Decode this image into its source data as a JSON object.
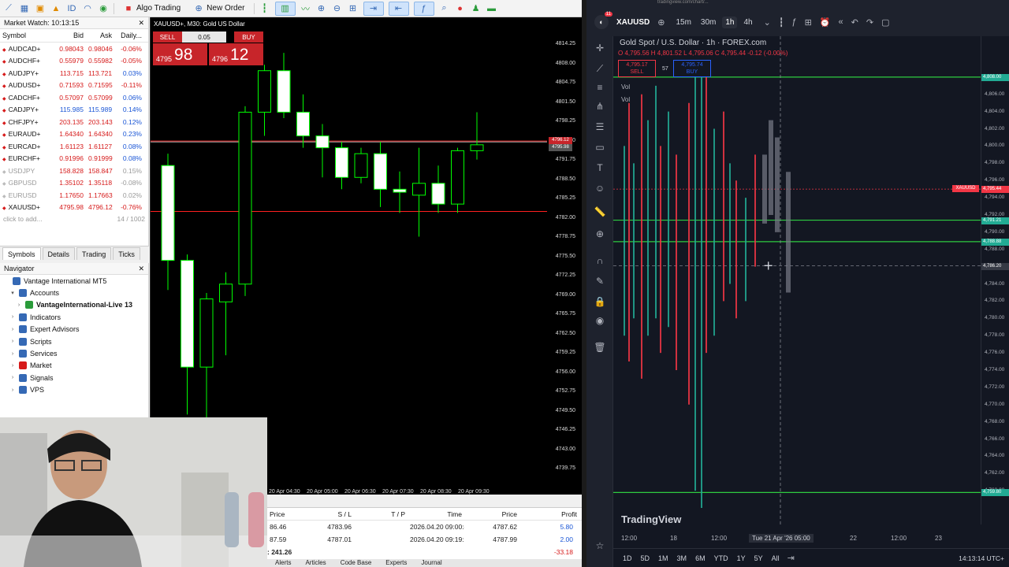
{
  "mt5": {
    "toolbar": {
      "algo_trading": "Algo Trading",
      "new_order": "New Order"
    },
    "market_watch": {
      "title": "Market Watch: 10:13:15",
      "columns": [
        "Symbol",
        "Bid",
        "Ask",
        "Daily..."
      ],
      "rows": [
        {
          "symbol": "AUDCAD+",
          "bid": "0.98043",
          "ask": "0.98046",
          "change": "-0.06%",
          "dir": "down",
          "dim": false
        },
        {
          "symbol": "AUDCHF+",
          "bid": "0.55979",
          "ask": "0.55982",
          "change": "-0.05%",
          "dir": "down",
          "dim": false
        },
        {
          "symbol": "AUDJPY+",
          "bid": "113.715",
          "ask": "113.721",
          "change": "0.03%",
          "dir": "down",
          "dim": false
        },
        {
          "symbol": "AUDUSD+",
          "bid": "0.71593",
          "ask": "0.71595",
          "change": "-0.11%",
          "dir": "down",
          "dim": false
        },
        {
          "symbol": "CADCHF+",
          "bid": "0.57097",
          "ask": "0.57099",
          "change": "0.06%",
          "dir": "down",
          "dim": false
        },
        {
          "symbol": "CADJPY+",
          "bid": "115.985",
          "ask": "115.989",
          "change": "0.14%",
          "dir": "up",
          "dim": false
        },
        {
          "symbol": "CHFJPY+",
          "bid": "203.135",
          "ask": "203.143",
          "change": "0.12%",
          "dir": "down",
          "dim": false
        },
        {
          "symbol": "EURAUD+",
          "bid": "1.64340",
          "ask": "1.64340",
          "change": "0.23%",
          "dir": "down",
          "dim": false
        },
        {
          "symbol": "EURCAD+",
          "bid": "1.61123",
          "ask": "1.61127",
          "change": "0.08%",
          "dir": "down",
          "dim": false
        },
        {
          "symbol": "EURCHF+",
          "bid": "0.91996",
          "ask": "0.91999",
          "change": "0.08%",
          "dir": "down",
          "dim": false
        },
        {
          "symbol": "USDJPY",
          "bid": "158.828",
          "ask": "158.847",
          "change": "0.15%",
          "dir": "down",
          "dim": true
        },
        {
          "symbol": "GBPUSD",
          "bid": "1.35102",
          "ask": "1.35118",
          "change": "-0.08%",
          "dir": "down",
          "dim": true
        },
        {
          "symbol": "EURUSD",
          "bid": "1.17650",
          "ask": "1.17663",
          "change": "0.02%",
          "dir": "down",
          "dim": true
        },
        {
          "symbol": "XAUUSD+",
          "bid": "4795.98",
          "ask": "4796.12",
          "change": "-0.76%",
          "dir": "down",
          "dim": false
        }
      ],
      "add_label": "click to add...",
      "count": "14 / 1002",
      "tabs": [
        "Symbols",
        "Details",
        "Trading",
        "Ticks"
      ]
    },
    "navigator": {
      "title": "Navigator",
      "items": [
        {
          "label": "Vantage International MT5",
          "level": 0,
          "caret": "",
          "color": "#3569b5"
        },
        {
          "label": "Accounts",
          "level": 1,
          "caret": "▾",
          "color": "#3569b5"
        },
        {
          "label": "VantageInternational-Live 13",
          "level": 2,
          "caret": "›",
          "color": "#2a9b3a",
          "bold": true
        },
        {
          "label": "Indicators",
          "level": 1,
          "caret": "›",
          "color": "#3569b5"
        },
        {
          "label": "Expert Advisors",
          "level": 1,
          "caret": "›",
          "color": "#3569b5"
        },
        {
          "label": "Scripts",
          "level": 1,
          "caret": "›",
          "color": "#3569b5"
        },
        {
          "label": "Services",
          "level": 1,
          "caret": "›",
          "color": "#3569b5"
        },
        {
          "label": "Market",
          "level": 1,
          "caret": "›",
          "color": "#d61a1a"
        },
        {
          "label": "Signals",
          "level": 1,
          "caret": "›",
          "color": "#3569b5"
        },
        {
          "label": "VPS",
          "level": 1,
          "caret": "›",
          "color": "#3569b5"
        }
      ]
    },
    "chart": {
      "title": "XAUUSD+, M30: Gold US Dollar",
      "sell_label": "SELL",
      "buy_label": "BUY",
      "lot": "0.05",
      "sell_price_small": "4795",
      "sell_price_big": "98",
      "buy_price_small": "4796",
      "buy_price_big": "12",
      "price_labels": [
        "4814.25",
        "4808.00",
        "4804.75",
        "4801.50",
        "4798.25",
        "4795.00",
        "4791.75",
        "4788.50",
        "4785.25",
        "4782.00",
        "4778.75",
        "4775.50",
        "4772.25",
        "4769.00",
        "4765.75",
        "4762.50",
        "4759.25",
        "4756.00",
        "4752.75",
        "4749.50",
        "4746.25",
        "4743.00",
        "4739.75"
      ],
      "time_labels": [
        "20 Apr 04:30",
        "20 Apr 05:00",
        "20 Apr 06:30",
        "20 Apr 07:30",
        "20 Apr 08:30",
        "20 Apr 09:30"
      ],
      "candles": [
        {
          "o": 4792.0,
          "h": 4794.0,
          "l": 4771.0,
          "c": 4776.0
        },
        {
          "o": 4776.0,
          "h": 4777.0,
          "l": 4750.0,
          "c": 4758.0
        },
        {
          "o": 4758.0,
          "h": 4770.5,
          "l": 4746.0,
          "c": 4769.5
        },
        {
          "o": 4769.0,
          "h": 4774.0,
          "l": 4760.0,
          "c": 4772.0
        },
        {
          "o": 4772.0,
          "h": 4802.0,
          "l": 4770.0,
          "c": 4801.0
        },
        {
          "o": 4801.0,
          "h": 4809.0,
          "l": 4797.0,
          "c": 4808.0
        },
        {
          "o": 4808.0,
          "h": 4811.0,
          "l": 4800.0,
          "c": 4801.0
        },
        {
          "o": 4801.0,
          "h": 4804.0,
          "l": 4795.0,
          "c": 4797.0
        },
        {
          "o": 4797.0,
          "h": 4799.0,
          "l": 4790.0,
          "c": 4795.0
        },
        {
          "o": 4795.0,
          "h": 4796.0,
          "l": 4788.0,
          "c": 4790.0
        },
        {
          "o": 4790.0,
          "h": 4795.0,
          "l": 4789.0,
          "c": 4794.0
        },
        {
          "o": 4794.0,
          "h": 4796.0,
          "l": 4785.0,
          "c": 4788.0
        },
        {
          "o": 4788.0,
          "h": 4791.0,
          "l": 4784.0,
          "c": 4787.5
        },
        {
          "o": 4787.0,
          "h": 4795.0,
          "l": 4780.0,
          "c": 4789.0
        },
        {
          "o": 4789.0,
          "h": 4792.0,
          "l": 4784.0,
          "c": 4785.5
        },
        {
          "o": 4785.5,
          "h": 4795.0,
          "l": 4784.0,
          "c": 4794.5
        },
        {
          "o": 4794.5,
          "h": 4801.0,
          "l": 4793.0,
          "c": 4795.5
        }
      ],
      "ask_line": 4796.12,
      "bid_line": 4795.98,
      "level_line": 4784.25,
      "ask_label": "4796.12",
      "bid_label": "4795.98"
    },
    "toolbox": {
      "columns": [
        "Price",
        "S / L",
        "T / P",
        "Time",
        "Price",
        "Profit"
      ],
      "rows": [
        {
          "open": "86.46",
          "sl": "4783.96",
          "tp": "",
          "time": "2026.04.20 09:00:49",
          "price": "4787.62",
          "profit": "5.80"
        },
        {
          "open": "87.59",
          "sl": "4787.01",
          "tp": "",
          "time": "2026.04.20 09:19:25",
          "price": "4787.99",
          "profit": "2.00"
        }
      ],
      "balance": ": 241.26",
      "total_profit": "-33.18",
      "tabs": [
        "Alerts",
        "Articles",
        "Code Base",
        "Experts",
        "Journal"
      ]
    }
  },
  "tv": {
    "url": "tradingview.com/chart/...",
    "symbol": "XAUUSD",
    "notif_count": "11",
    "intervals": [
      {
        "label": "15m",
        "active": false
      },
      {
        "label": "30m",
        "active": false
      },
      {
        "label": "1h",
        "active": true
      },
      {
        "label": "4h",
        "active": false
      }
    ],
    "legend_title": "Gold Spot / U.S. Dollar · 1h · FOREX.com",
    "ohlc": "O 4,795.56  H 4,801.52  L 4,795.06  C 4,795.44  -0.12 (-0.00%)",
    "sell_price": "4,795.17",
    "sell_label": "SELL",
    "spread": "57",
    "buy_price": "4,795.74",
    "buy_label": "BUY",
    "vol_label": "Vol",
    "watermark": "TradingView",
    "price_labels": [
      "4,808.00",
      "4,806.00",
      "4,804.00",
      "4,802.00",
      "4,800.00",
      "4,798.00",
      "4,796.00",
      "4,794.00",
      "4,792.00",
      "4,790.00",
      "4,788.00",
      "4,786.00",
      "4,784.00",
      "4,782.00",
      "4,780.00",
      "4,778.00",
      "4,776.00",
      "4,774.00",
      "4,772.00",
      "4,770.00",
      "4,768.00",
      "4,766.00",
      "4,764.00",
      "4,762.00",
      "4,760.00"
    ],
    "badges": [
      {
        "label": "4,808.00",
        "value": 4808.0,
        "color": "#22ab94"
      },
      {
        "label": "4,795.44",
        "value": 4795.0,
        "color": "#f23645"
      },
      {
        "label": "4,791.21",
        "value": 4791.4,
        "color": "#22ab94"
      },
      {
        "label": "4,788.88",
        "value": 4788.9,
        "color": "#22ab94"
      },
      {
        "label": "4,786.20",
        "value": 4786.1,
        "color": "#363a45"
      },
      {
        "label": "4,759.80",
        "value": 4759.8,
        "color": "#22ab94"
      }
    ],
    "xau_tag": "XAUUSD",
    "levels": [
      4808.0,
      4791.4,
      4788.9,
      4759.8
    ],
    "crosshair_price": 4786.1,
    "time_labels": [
      {
        "label": "12:00",
        "highlight": false
      },
      {
        "label": "18",
        "highlight": false
      },
      {
        "label": "12:00",
        "highlight": false
      },
      {
        "label": "Tue 21 Apr '26   05:00",
        "highlight": true
      },
      {
        "label": "22",
        "highlight": false
      },
      {
        "label": "12:00",
        "highlight": false
      },
      {
        "label": "23",
        "highlight": false
      }
    ],
    "ranges": [
      "1D",
      "5D",
      "1M",
      "3M",
      "6M",
      "YTD",
      "1Y",
      "5Y",
      "All"
    ],
    "clock": "14:13:14 UTC+"
  },
  "colors": {
    "mt5_bull": "#00ff00",
    "mt5_bear": "#ffffff",
    "tv_bg": "#131722",
    "tv_up": "#22ab94",
    "tv_down": "#f23645"
  }
}
